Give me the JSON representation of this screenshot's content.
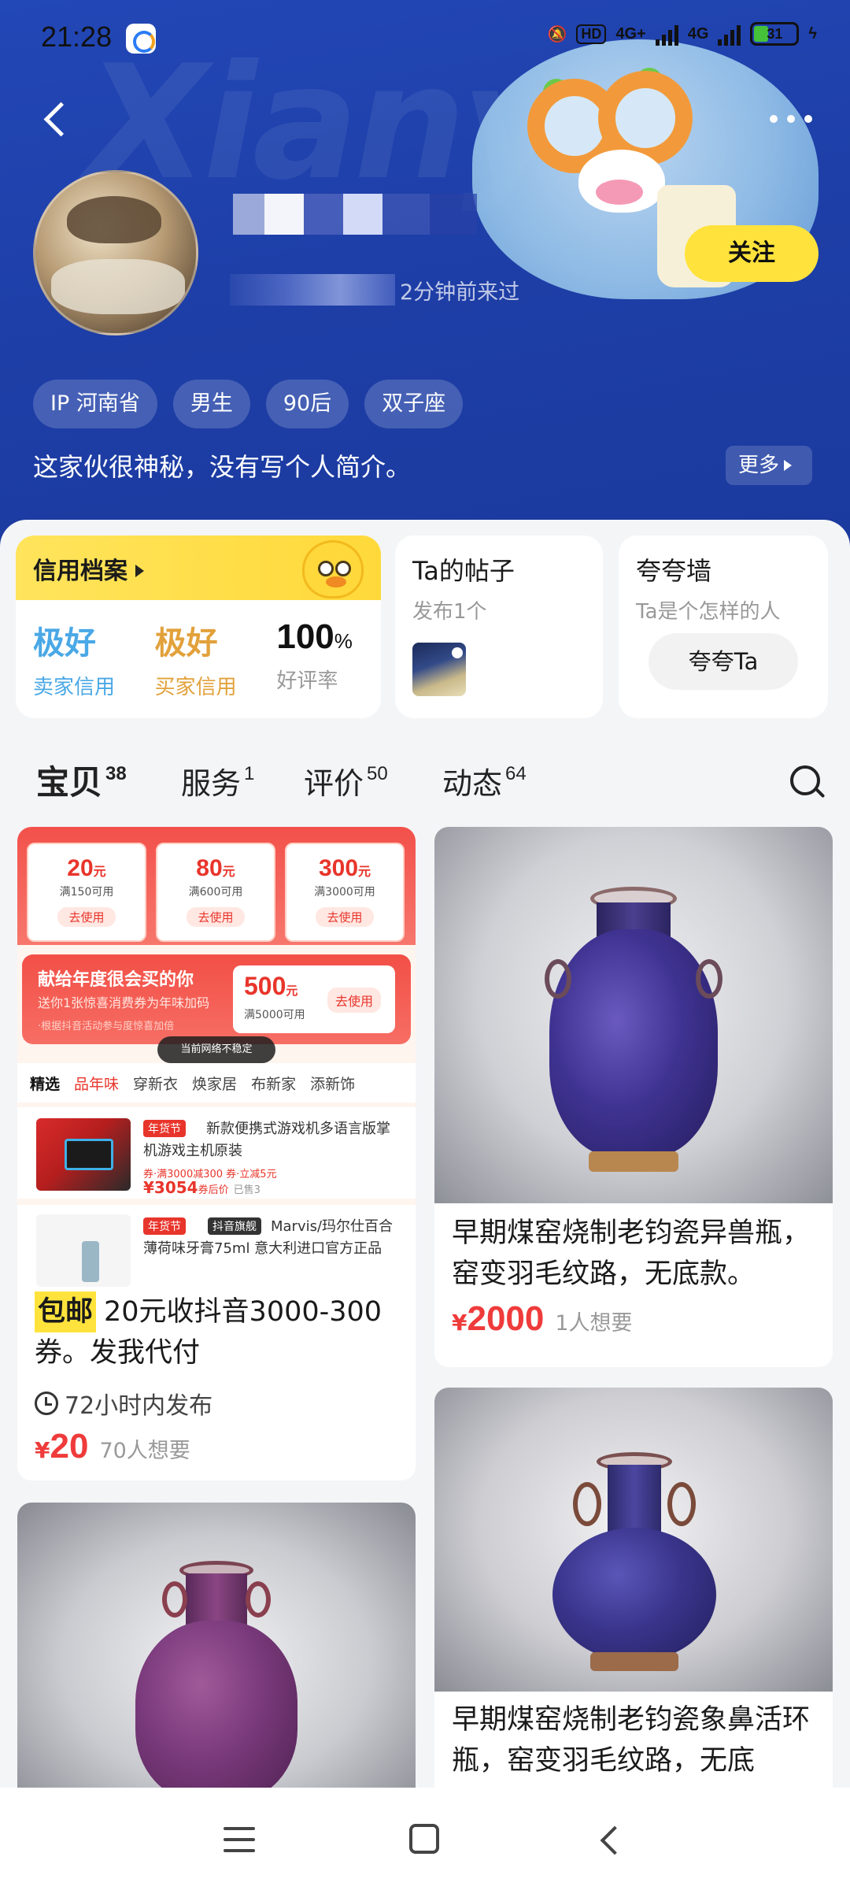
{
  "status_bar": {
    "time": "21:28",
    "hd": "HD",
    "net1": "4G+",
    "net2": "4G",
    "battery": "31"
  },
  "profile": {
    "last_seen_suffix": "2分钟前来过",
    "follow_label": "关注",
    "tags": [
      "IP 河南省",
      "男生",
      "90后",
      "双子座"
    ],
    "bio": "这家伙很神秘，没有写个人简介。",
    "more_label": "更多"
  },
  "credit": {
    "title": "信用档案",
    "seller_value": "极好",
    "seller_label": "卖家信用",
    "buyer_value": "极好",
    "buyer_label": "买家信用",
    "rate_value": "100",
    "rate_unit": "%",
    "rate_label": "好评率"
  },
  "posts": {
    "title": "Ta的帖子",
    "subtitle": "发布1个"
  },
  "praise": {
    "title": "夸夸墙",
    "subtitle": "Ta是个怎样的人",
    "button": "夸夸Ta"
  },
  "tabs": [
    {
      "label": "宝贝",
      "count": "38"
    },
    {
      "label": "服务",
      "count": "1"
    },
    {
      "label": "评价",
      "count": "50"
    },
    {
      "label": "动态",
      "count": "64"
    }
  ],
  "coupon_image": {
    "coupons": [
      {
        "amount": "20",
        "unit": "元",
        "cond": "满150可用",
        "use": "去使用"
      },
      {
        "amount": "80",
        "unit": "元",
        "cond": "满600可用",
        "use": "去使用"
      },
      {
        "amount": "300",
        "unit": "元",
        "cond": "满3000可用",
        "use": "去使用"
      }
    ],
    "gift_title": "献给年度很会买的你",
    "gift_sub": "送你1张惊喜消费券为年味加码",
    "gift_note": "·根据抖音活动参与度惊喜加倍",
    "big_amount": "500",
    "big_unit": "元",
    "big_cond": "满5000可用",
    "big_use": "去使用",
    "toast": "当前网络不稳定",
    "nav": [
      "精选",
      "品年味",
      "穿新衣",
      "焕家居",
      "布新家",
      "添新饰"
    ],
    "item1_badge": "年货节",
    "item1_desc": "新款便携式游戏机多语言版掌机游戏主机原装",
    "item1_promo": "券·满3000减300  券·立减5元",
    "item1_price": "¥3054",
    "item1_after": "券后价",
    "item1_sold": "已售3",
    "item2_badge": "年货节",
    "item2_badge2": "抖音旗舰",
    "item2_desc": "Marvis/玛尔仕百合薄荷味牙膏75ml 意大利进口官方正品"
  },
  "products": [
    {
      "badge": "包邮",
      "title": "20元收抖音3000-300券。发我代付",
      "time": "72小时内发布",
      "currency": "¥",
      "price": "20",
      "want": "70人想要"
    },
    {
      "title": "早期煤窑烧制老钧瓷异兽瓶，窑变羽毛纹路，无底款。",
      "currency": "¥",
      "price": "2000",
      "want": "1人想要"
    },
    {
      "title": ""
    },
    {
      "title": "早期煤窑烧制老钧瓷象鼻活环瓶，窑变羽毛纹路，无底"
    }
  ],
  "colors": {
    "header_blue": "#1f42ad",
    "accent_yellow": "#ffe33c",
    "price_red": "#ef3b3b",
    "seller_blue": "#4aa8e6",
    "buyer_orange": "#e2a13b"
  },
  "icons": [
    "back-icon",
    "more-dots-icon",
    "search-icon",
    "clock-icon",
    "menu-icon",
    "home-icon",
    "nav-back-icon"
  ]
}
